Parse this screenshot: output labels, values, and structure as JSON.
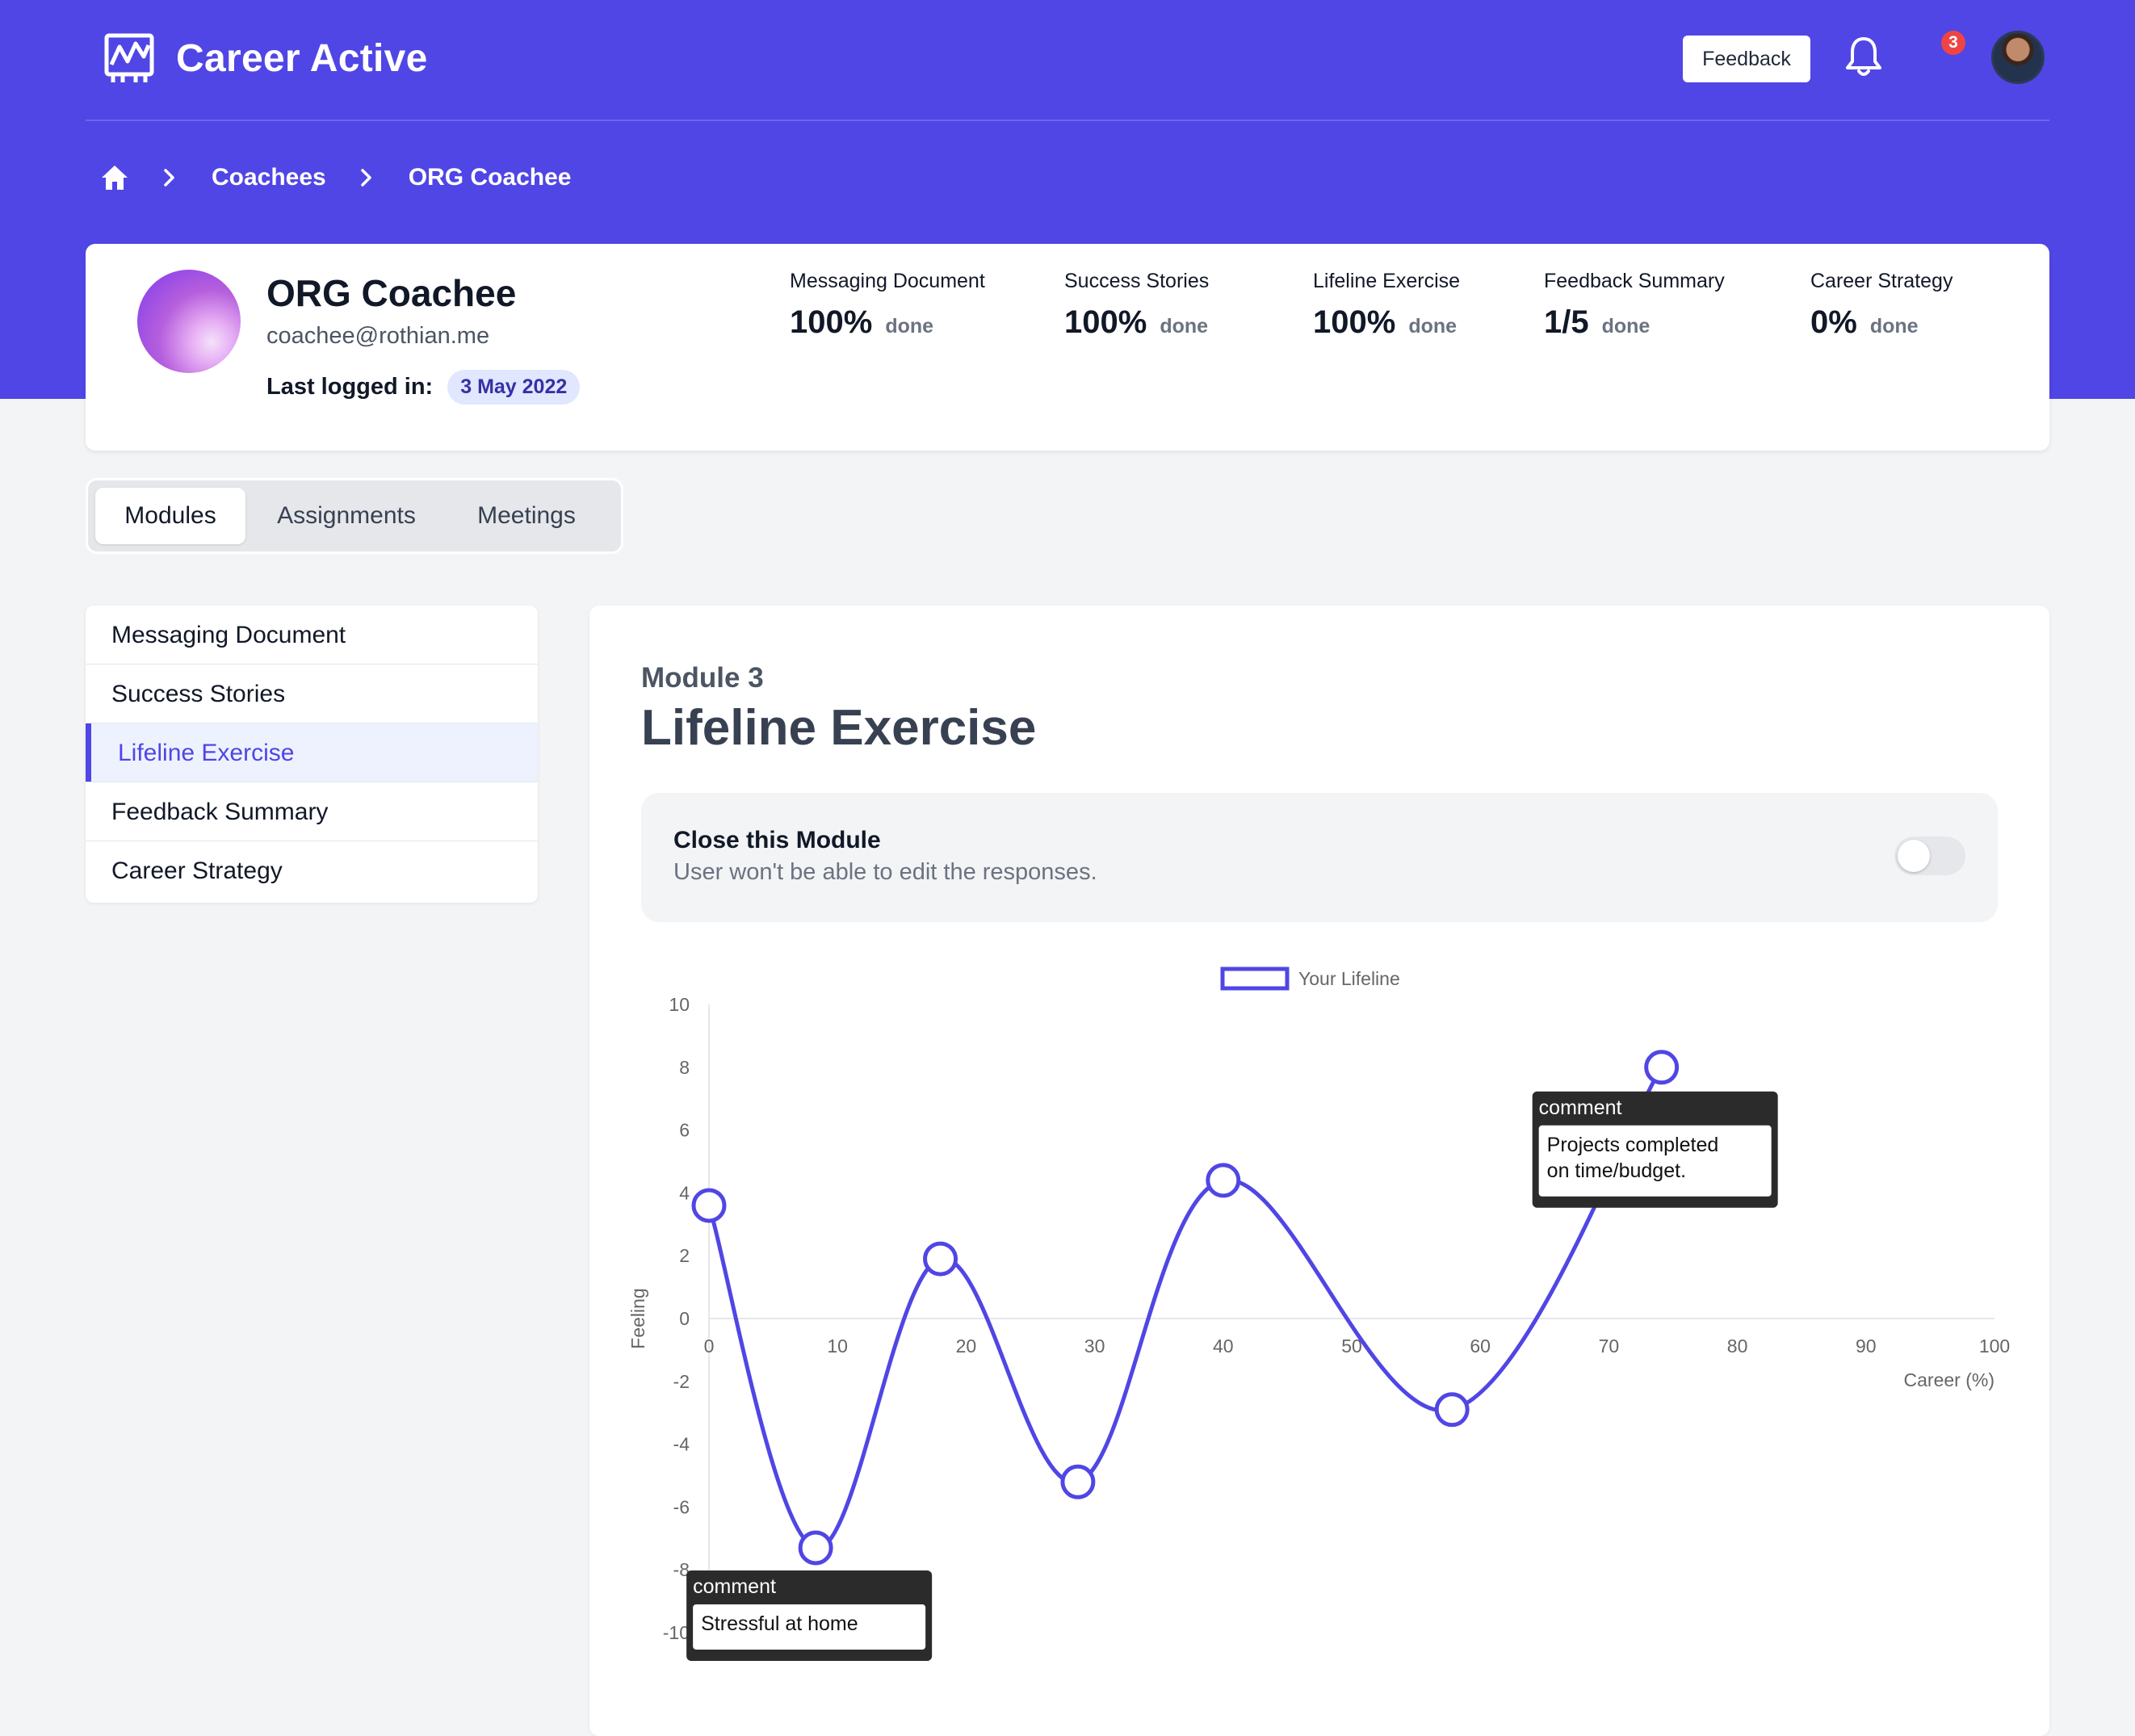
{
  "app": {
    "title": "Career Active"
  },
  "header": {
    "feedback_label": "Feedback",
    "notification_count": "3"
  },
  "breadcrumb": {
    "items": [
      "Coachees",
      "ORG Coachee"
    ]
  },
  "profile": {
    "name": "ORG Coachee",
    "email": "coachee@rothian.me",
    "last_logged_label": "Last logged in:",
    "last_logged_date": "3 May 2022"
  },
  "stats": [
    {
      "label": "Messaging Document",
      "value": "100%",
      "unit": "done"
    },
    {
      "label": "Success Stories",
      "value": "100%",
      "unit": "done"
    },
    {
      "label": "Lifeline Exercise",
      "value": "100%",
      "unit": "done"
    },
    {
      "label": "Feedback Summary",
      "value": "1/5",
      "unit": "done"
    },
    {
      "label": "Career Strategy",
      "value": "0%",
      "unit": "done"
    }
  ],
  "tabs": [
    {
      "label": "Modules",
      "active": true
    },
    {
      "label": "Assignments",
      "active": false
    },
    {
      "label": "Meetings",
      "active": false
    }
  ],
  "modules_menu": [
    {
      "label": "Messaging Document",
      "active": false
    },
    {
      "label": "Success Stories",
      "active": false
    },
    {
      "label": "Lifeline Exercise",
      "active": true
    },
    {
      "label": "Feedback Summary",
      "active": false
    },
    {
      "label": "Career Strategy",
      "active": false
    }
  ],
  "module": {
    "kicker": "Module 3",
    "title": "Lifeline Exercise",
    "close_title": "Close this Module",
    "close_desc": "User won't be able to edit the responses.",
    "close_toggle_on": false
  },
  "colors": {
    "brand": "#5046e5",
    "accent": "#4f46e5",
    "line": "#5046e5"
  },
  "chart_data": {
    "type": "line",
    "title": "",
    "xlabel": "Career (%)",
    "ylabel": "Feeling",
    "xlim": [
      0,
      100
    ],
    "ylim": [
      -10,
      10
    ],
    "xticks": [
      0,
      10,
      20,
      30,
      40,
      50,
      60,
      70,
      80,
      90,
      100
    ],
    "yticks": [
      10,
      8,
      6,
      4,
      2,
      0,
      -2,
      -4,
      -6,
      -8,
      -10
    ],
    "legend": "top-center",
    "series": [
      {
        "name": "Your Lifeline",
        "x": [
          0,
          8.3,
          18,
          28.7,
          40,
          57.8,
          74.1
        ],
        "y": [
          3.6,
          -7.3,
          1.9,
          -5.2,
          4.4,
          -2.9,
          8
        ]
      }
    ],
    "tooltips": [
      {
        "title": "comment",
        "text": [
          "Projects completed",
          "on time/budget."
        ],
        "point_index": 6
      },
      {
        "title": "comment",
        "text": [
          "Stressful at home"
        ],
        "point_index": 1
      }
    ]
  }
}
